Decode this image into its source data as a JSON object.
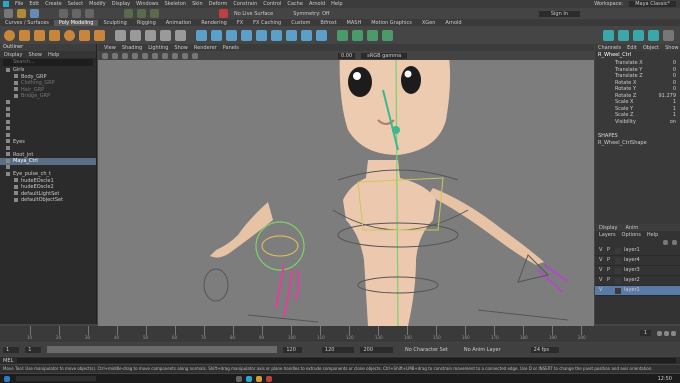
{
  "menubar": {
    "items": [
      "File",
      "Edit",
      "Create",
      "Select",
      "Modify",
      "Display",
      "Windows",
      "Skeleton",
      "Skin",
      "Deform",
      "Constrain",
      "Control",
      "Cache",
      "Arnold",
      "Help"
    ],
    "workspace_label": "Workspace:",
    "workspace_value": "Maya Classic*"
  },
  "status": {
    "live_surface": "No Live Surface",
    "symmetry": "Symmetry: Off",
    "sign_in": "Sign In"
  },
  "shelf_tabs": [
    "Curves / Surfaces",
    "Poly Modeling",
    "Sculpting",
    "Rigging",
    "Animation",
    "Rendering",
    "FX",
    "FX Caching",
    "Custom",
    "Bifrost",
    "MASH",
    "Motion Graphics",
    "XGen",
    "Arnold"
  ],
  "shelf_active_index": 1,
  "outliner": {
    "title": "Outliner",
    "menus": [
      "Display",
      "Show",
      "Help"
    ],
    "search_placeholder": "Search...",
    "items": [
      "Girls",
      "Body_GRP",
      "Clothing_GRP",
      "Hair_GRP",
      "Bridge_GRP",
      "",
      "",
      "",
      "",
      "",
      "",
      "Eyes",
      "",
      "Root_jnt",
      "Maya_Ctrl",
      "",
      "Eye_pulse_ch_t",
      "hudeEOscle1",
      "hudeEOscle2",
      "defaultLightSet",
      "defaultObjectSet"
    ],
    "selected_index": 14
  },
  "viewport": {
    "menus": [
      "View",
      "Shading",
      "Lighting",
      "Show",
      "Renderer",
      "Panels"
    ],
    "field_value": "0.00",
    "colorspace": "sRGB gamma"
  },
  "channel_box": {
    "menus": [
      "Channels",
      "Edit",
      "Object",
      "Show"
    ],
    "object": "R_Wheel_Ctrl",
    "attrs": [
      {
        "name": "Translate X",
        "value": "0"
      },
      {
        "name": "Translate Y",
        "value": "0"
      },
      {
        "name": "Translate Z",
        "value": "0"
      },
      {
        "name": "Rotate X",
        "value": "0"
      },
      {
        "name": "Rotate Y",
        "value": "0"
      },
      {
        "name": "Rotate Z",
        "value": "91.279"
      },
      {
        "name": "Scale X",
        "value": "1"
      },
      {
        "name": "Scale Y",
        "value": "1"
      },
      {
        "name": "Scale Z",
        "value": "1"
      },
      {
        "name": "Visibility",
        "value": "on"
      }
    ],
    "shapes_label": "SHAPES",
    "shape": "R_Wheel_CtrlShape"
  },
  "layers": {
    "tabs": [
      "Display",
      "Anim"
    ],
    "menus": [
      "Layers",
      "Options",
      "Help"
    ],
    "rows": [
      {
        "v": "V",
        "p": "P",
        "name": "layer1"
      },
      {
        "v": "V",
        "p": "P",
        "name": "layer4"
      },
      {
        "v": "V",
        "p": "P",
        "name": "layer3"
      },
      {
        "v": "V",
        "p": "P",
        "name": "layer2"
      },
      {
        "v": "V",
        "p": "",
        "name": "layer1"
      }
    ],
    "selected_index": 4
  },
  "timeline": {
    "ticks": [
      "10",
      "20",
      "30",
      "40",
      "50",
      "60",
      "70",
      "80",
      "90",
      "100",
      "110",
      "120",
      "130",
      "140",
      "150",
      "160",
      "170",
      "180",
      "190",
      "200"
    ],
    "current_frame": "1"
  },
  "range": {
    "start": "1",
    "start_inner": "1",
    "end_inner": "120",
    "end": "120",
    "end_total": "200",
    "char_set": "No Character Set",
    "anim_layer": "No Anim Layer",
    "fps": "24 fps"
  },
  "command_line": {
    "mode": "MEL"
  },
  "help_line": {
    "text": "Move Tool: Use manipulator to move object(s). Ctrl+middle-drag to move components along normals. Shift+drag manipulator axis or plane handles to extrude components or clone objects. Ctrl+Shift+LMB+drag to constrain movement to a connected edge. Use D or INSERT to change the pivot position and axis orientation."
  },
  "taskbar": {
    "time": "12:50"
  },
  "colors": {
    "accent_select": "#5a6f86",
    "viewport_bg": "#7d7d7d",
    "skin": "#eccbb0",
    "control_pink": "#e040a0",
    "control_green": "#7dd16a"
  }
}
